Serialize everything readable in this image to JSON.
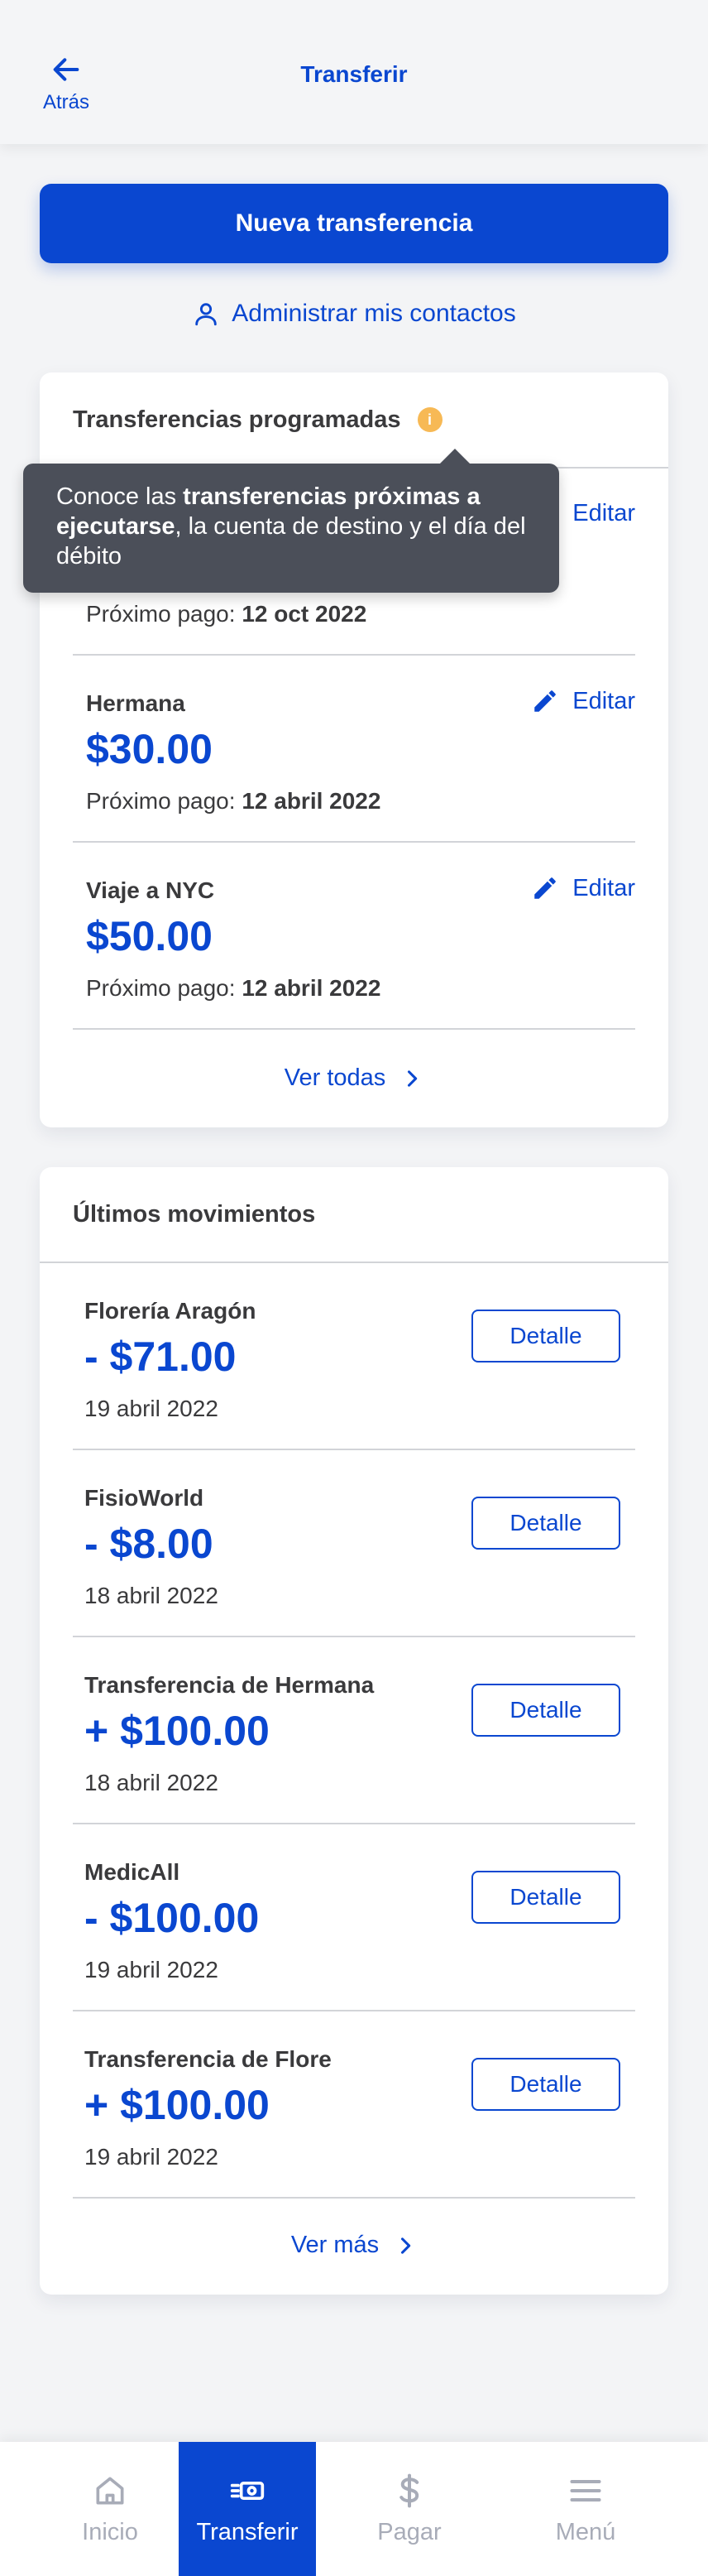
{
  "header": {
    "title": "Transferir",
    "back_label": "Atrás"
  },
  "actions": {
    "new_transfer": "Nueva transferencia",
    "manage_contacts": "Administrar mis contactos"
  },
  "scheduled": {
    "title": "Transferencias programadas",
    "info_glyph": "i",
    "tooltip": {
      "pre": "Conoce las ",
      "bold": "transferencias próximas a ejecutarse",
      "post": ", la cuenta de destino y el día del débito"
    },
    "next_label": "Próximo pago:",
    "edit_label": "Editar",
    "items": [
      {
        "name": "",
        "amount": "",
        "next_date": "12 oct 2022"
      },
      {
        "name": "Hermana",
        "amount": "$30.00",
        "next_date": "12 abril 2022"
      },
      {
        "name": "Viaje a NYC",
        "amount": "$50.00",
        "next_date": "12 abril 2022"
      }
    ],
    "see_all": "Ver todas"
  },
  "movements": {
    "title": "Últimos movimientos",
    "detail_label": "Detalle",
    "items": [
      {
        "name": "Florería Aragón",
        "amount": "- $71.00",
        "date": "19 abril 2022"
      },
      {
        "name": "FisioWorld",
        "amount": "- $8.00",
        "date": "18 abril 2022"
      },
      {
        "name": "Transferencia de Hermana",
        "amount": "+ $100.00",
        "date": "18 abril 2022"
      },
      {
        "name": "MedicAll",
        "amount": "- $100.00",
        "date": "19 abril 2022"
      },
      {
        "name": "Transferencia de Flore",
        "amount": "+ $100.00",
        "date": "19 abril 2022"
      }
    ],
    "see_more": "Ver más"
  },
  "nav": {
    "items": [
      {
        "label": "Inicio",
        "icon": "home-icon"
      },
      {
        "label": "Transferir",
        "icon": "transfer-icon"
      },
      {
        "label": "Pagar",
        "icon": "dollar-icon"
      },
      {
        "label": "Menú",
        "icon": "menu-icon"
      }
    ],
    "active": "Transferir"
  },
  "colors": {
    "primary": "#0a47d0",
    "background": "#f3f4f6",
    "tooltip": "#4b4f59",
    "info_badge": "#f7b955"
  }
}
